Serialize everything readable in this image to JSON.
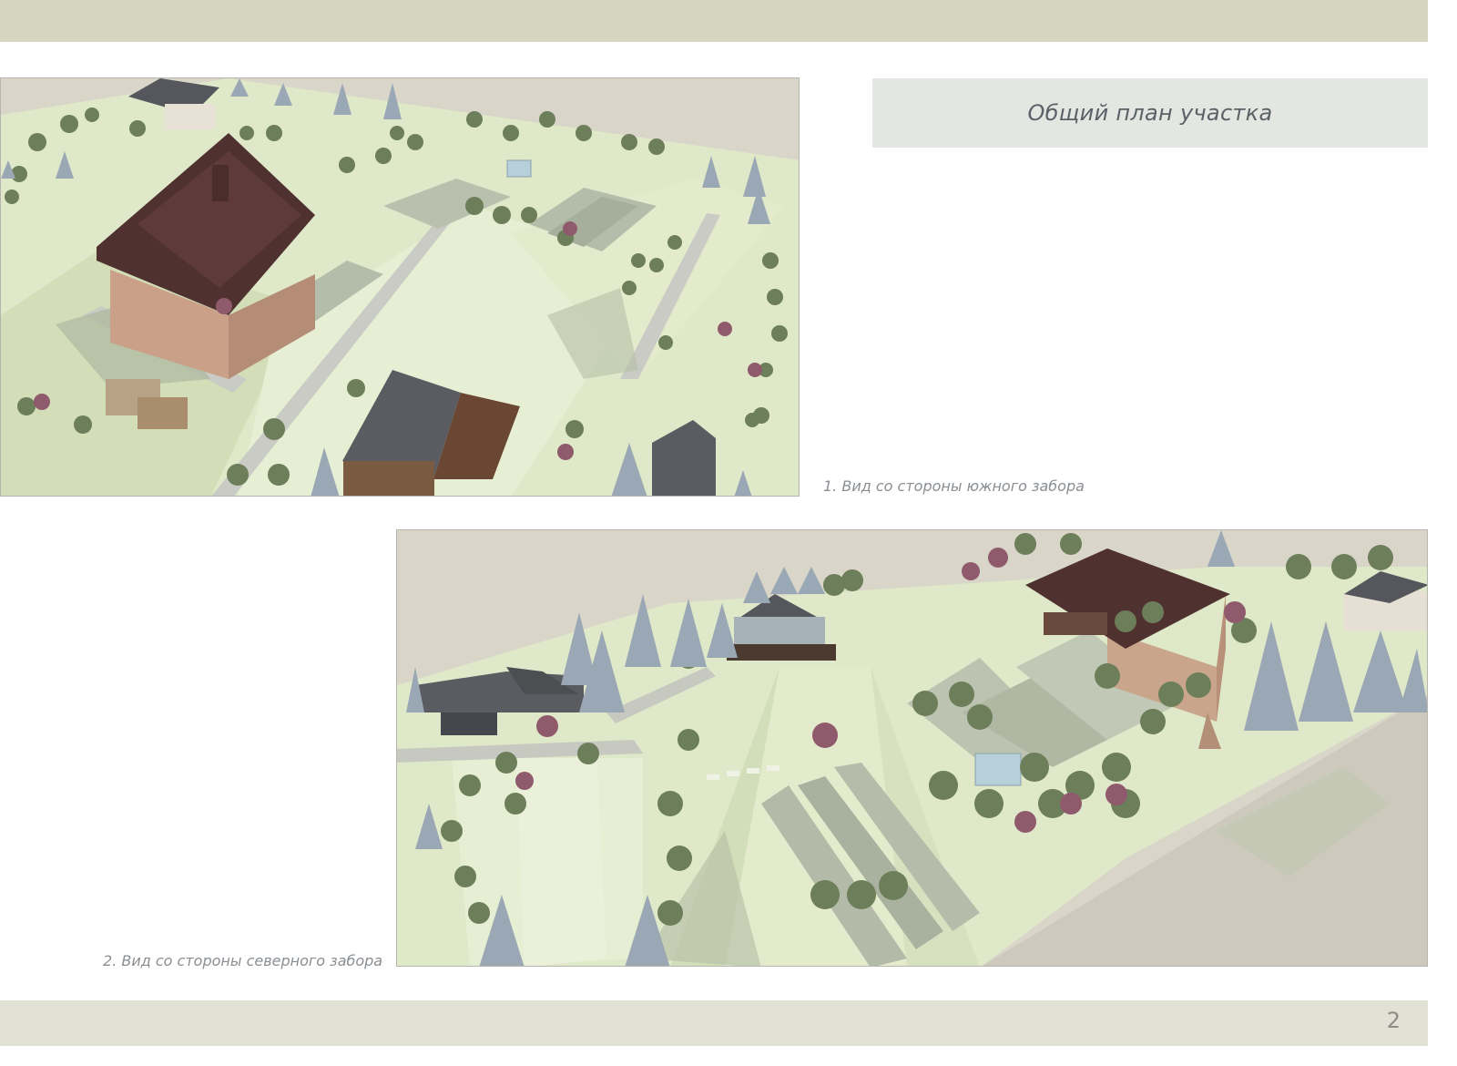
{
  "page_title": "Общий план участка",
  "page_number": "2",
  "views": [
    {
      "caption": "1. Вид со стороны южного забора",
      "image": "aerial-render-south-fence"
    },
    {
      "caption": "2. Вид со стороны северного забора",
      "image": "aerial-render-north-fence"
    }
  ],
  "colors": {
    "top_band": "#d6d6c0",
    "bottom_band": "#e1e1d6",
    "title_box": "#e4e7e1",
    "title_text": "#5a6268",
    "caption_text": "#8a8f94",
    "lawn": "#dfe8c8",
    "roof": "#4f3230",
    "conifer": "#9aa7b4"
  }
}
